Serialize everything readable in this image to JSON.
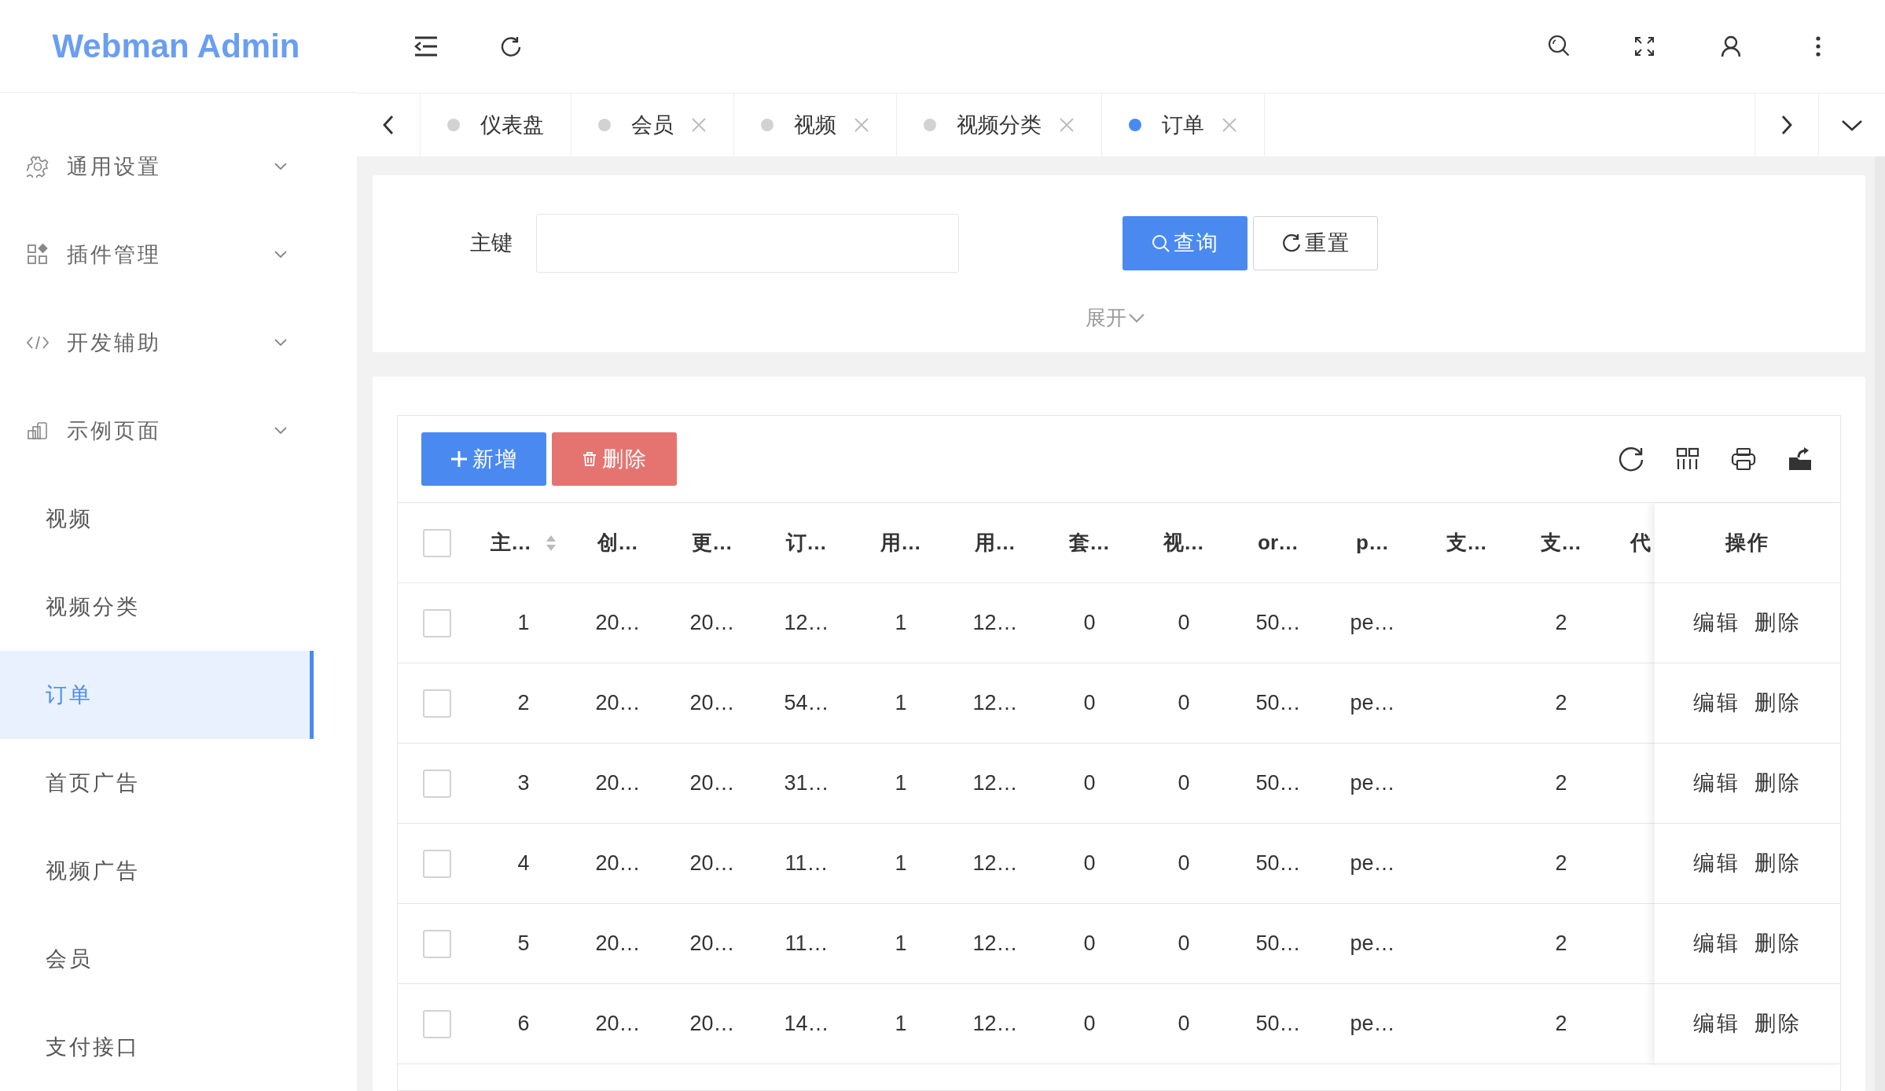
{
  "app": {
    "logo": "Webman Admin"
  },
  "sidebar": {
    "items": [
      {
        "label": "通用设置"
      },
      {
        "label": "插件管理"
      },
      {
        "label": "开发辅助"
      },
      {
        "label": "示例页面",
        "children": [
          {
            "label": "视频",
            "selected": false
          },
          {
            "label": "视频分类",
            "selected": false
          },
          {
            "label": "订单",
            "selected": true
          },
          {
            "label": "首页广告",
            "selected": false
          },
          {
            "label": "视频广告",
            "selected": false
          },
          {
            "label": "会员",
            "selected": false
          },
          {
            "label": "支付接口",
            "selected": false
          }
        ]
      }
    ]
  },
  "tabs": [
    {
      "label": "仪表盘",
      "selected": false,
      "closable": false
    },
    {
      "label": "会员",
      "selected": false,
      "closable": true
    },
    {
      "label": "视频",
      "selected": false,
      "closable": true
    },
    {
      "label": "视频分类",
      "selected": false,
      "closable": true
    },
    {
      "label": "订单",
      "selected": true,
      "closable": true
    }
  ],
  "search": {
    "fields": [
      {
        "label": "主键"
      }
    ],
    "buttons": [
      {
        "label": "查询",
        "kind": "primary"
      },
      {
        "label": "重置",
        "kind": "default"
      }
    ],
    "toggle": "展开"
  },
  "table": {
    "buttons": [
      {
        "label": "新增",
        "kind": "add"
      },
      {
        "label": "删除",
        "kind": "delete"
      }
    ],
    "select_all": {
      "checked": false
    },
    "columns": [
      {
        "label": "主…",
        "sortable": true
      },
      {
        "label": "创…"
      },
      {
        "label": "更…"
      },
      {
        "label": "订…"
      },
      {
        "label": "用…"
      },
      {
        "label": "用…"
      },
      {
        "label": "套…"
      },
      {
        "label": "视…"
      },
      {
        "label": "or…"
      },
      {
        "label": "p…"
      },
      {
        "label": "支…"
      },
      {
        "label": "支…"
      },
      {
        "label": "代"
      }
    ],
    "action_column": "操作",
    "rows": [
      {
        "checked": false,
        "cells": [
          "1",
          "20…",
          "20…",
          "12…",
          "1",
          "12…",
          "0",
          "0",
          "50…",
          "pe…",
          null,
          "2"
        ],
        "actions": [
          "编辑",
          "删除"
        ]
      },
      {
        "checked": false,
        "cells": [
          "2",
          "20…",
          "20…",
          "54…",
          "1",
          "12…",
          "0",
          "0",
          "50…",
          "pe…",
          null,
          "2"
        ],
        "actions": [
          "编辑",
          "删除"
        ]
      },
      {
        "checked": false,
        "cells": [
          "3",
          "20…",
          "20…",
          "31…",
          "1",
          "12…",
          "0",
          "0",
          "50…",
          "pe…",
          null,
          "2"
        ],
        "actions": [
          "编辑",
          "删除"
        ]
      },
      {
        "checked": false,
        "cells": [
          "4",
          "20…",
          "20…",
          "11…",
          "1",
          "12…",
          "0",
          "0",
          "50…",
          "pe…",
          null,
          "2"
        ],
        "actions": [
          "编辑",
          "删除"
        ]
      },
      {
        "checked": false,
        "cells": [
          "5",
          "20…",
          "20…",
          "11…",
          "1",
          "12…",
          "0",
          "0",
          "50…",
          "pe…",
          null,
          "2"
        ],
        "actions": [
          "编辑",
          "删除"
        ]
      },
      {
        "checked": false,
        "cells": [
          "6",
          "20…",
          "20…",
          "14…",
          "1",
          "12…",
          "0",
          "0",
          "50…",
          "pe…",
          null,
          "2"
        ],
        "actions": [
          "编辑",
          "删除"
        ]
      }
    ]
  }
}
